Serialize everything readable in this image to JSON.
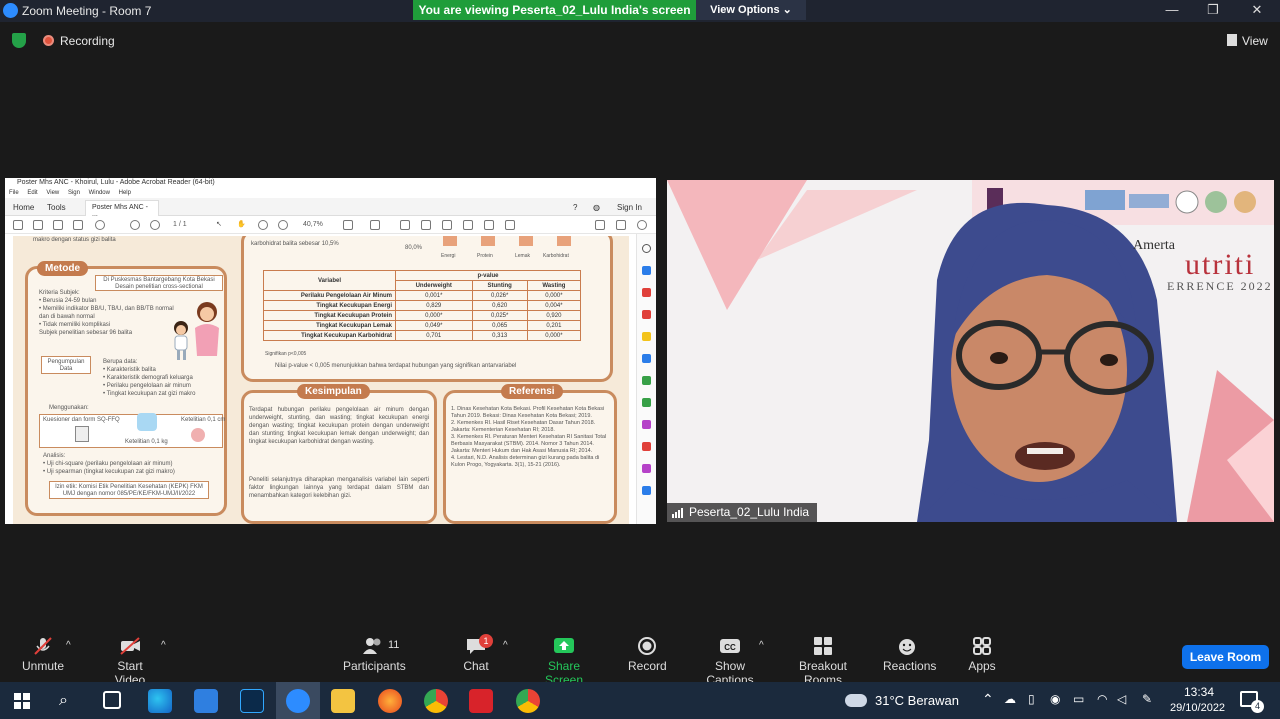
{
  "window": {
    "title": "Zoom Meeting - Room 7",
    "viewing_banner": "You are viewing Peserta_02_Lulu India's screen",
    "view_options": "View Options"
  },
  "top": {
    "recording": "Recording",
    "view": "View"
  },
  "acrobat": {
    "title": "Poster Mhs ANC - Khoirul, Lulu - Adobe Acrobat Reader (64-bit)",
    "menu": [
      "File",
      "Edit",
      "View",
      "Sign",
      "Window",
      "Help"
    ],
    "tabs": [
      "Home",
      "Tools"
    ],
    "active_tab": "Poster Mhs ANC - ...",
    "sign_in": "Sign In",
    "page": "1 / 1",
    "zoom": "40,7%"
  },
  "poster": {
    "metode_title": "Metode",
    "location": "Di Puskesmas Bantargebang Kota Bekasi Desain penelitian cross-sectional",
    "kriteria": "Kriteria Subjek:\n• Berusia 24-59 bulan\n• Memiliki indikator BB/U, TB/U, dan BB/TB normal dan di bawah normal\n• Tidak memiliki komplikasi\nSubjek penelitian sebesar 96 balita",
    "pengumpulan": "Pengumpulan Data",
    "berupa": "Berupa data:\n• Karakteristik balita\n• Karakteristik demografi keluarga\n• Perilaku pengelolaan air minum\n• Tingkat kecukupan zat gizi makro",
    "menggunakan": "Menggunakan:",
    "kuesioner": "Kuesioner dan form SQ-FFQ",
    "ketelitian_a": "Ketelitian 0,1 cm",
    "ketelitian_b": "Ketelitian 0,1 kg",
    "analisis": "Analisis:\n• Uji chi-square (perilaku pengelolaan air minum)\n• Uji spearman (tingkat kecukupan zat gizi makro)",
    "etik": "Izin etik: Komisi Etik Penelitian Kesehatan (KEPK) FKM UMJ dengan nomor 085/PE/KE/FKM-UMJ/II/2022",
    "top_note": "makro dengan status gizi balita",
    "carb_note": "karbohidrat balita sebesar 10,5%",
    "chart_labels": [
      "Energi",
      "Protein",
      "Lemak",
      "Karbohidrat"
    ],
    "chart_pct": "80,0%",
    "table_head": [
      "Variabel",
      "p-value"
    ],
    "table_sub": [
      "Underweight",
      "Stunting",
      "Wasting"
    ],
    "table_rows": [
      [
        "Perilaku Pengelolaan Air Minum",
        "0,001*",
        "0,026*",
        "0,000*"
      ],
      [
        "Tingkat Kecukupan Energi",
        "0,829",
        "0,620",
        "0,004*"
      ],
      [
        "Tingkat Kecukupan Protein",
        "0,000*",
        "0,025*",
        "0,920"
      ],
      [
        "Tingkat Kecukupan Lemak",
        "0,049*",
        "0,065",
        "0,201"
      ],
      [
        "Tingkat Kecukupan Karbohidrat",
        "0,701",
        "0,313",
        "0,000*"
      ]
    ],
    "signif": "Signifikan p<0,005",
    "nilai": "Nilai p-value < 0,005 menunjukkan bahwa terdapat hubungan yang signifikan antarvariabel",
    "kesimpulan_title": "Kesimpulan",
    "kesimpulan": "Terdapat hubungan perilaku pengelolaan air minum dengan underweight, stunting, dan wasting; tingkat kecukupan energi dengan wasting; tingkat kecukupan protein dengan underweight dan stunting; tingkat kecukupan lemak dengan underweight; dan tingkat kecukupan karbohidrat dengan wasting.",
    "saran": "Peneliti selanjutnya diharapkan menganalisis variabel lain seperti faktor lingkungan lainnya yang terdapat dalam STBM dan menambahkan kategori kelebihan gizi.",
    "referensi_title": "Referensi",
    "referensi": "1. Dinas Kesehatan Kota Bekasi. Profil Kesehatan Kota Bekasi Tahun 2019. Bekasi: Dinas Kesehatan Kota Bekasi; 2019.\n2. Kemenkes RI. Hasil Riset Kesehatan Dasar Tahun 2018. Jakarta: Kementerian Kesehatan RI; 2018.\n3. Kemenkes RI. Peraturan Menteri Kesehatan RI Sanitasi Total Berbasis Masyarakat (STBM). 2014. Nomor 3 Tahun 2014. Jakarta: Menteri Hukum dan Hak Asasi Manusia RI; 2014.\n4. Lestari, N.D. Analisis determinan gizi kurang pada balita di Kulon Progo, Yogyakarta. 3(1), 15-21 (2016)."
  },
  "participant": {
    "name": "Peserta_02_Lulu India",
    "bg_brand": "Amerta",
    "bg_title": "utriti",
    "bg_sub": "ERRENCE 2022"
  },
  "toolbar": {
    "unmute": "Unmute",
    "start_video": "Start Video",
    "participants": "Participants",
    "participants_count": "11",
    "chat": "Chat",
    "chat_badge": "1",
    "share": "Share Screen",
    "record": "Record",
    "captions": "Show Captions",
    "breakout": "Breakout Rooms",
    "reactions": "Reactions",
    "apps": "Apps",
    "leave": "Leave Room"
  },
  "taskbar": {
    "weather": "31°C  Berawan",
    "time": "13:34",
    "date": "29/10/2022",
    "notif": "4"
  },
  "colors": {
    "zoom_green": "#1f9d3a",
    "leave_blue": "#0e71eb",
    "share_green": "#24c75a",
    "poster_brown": "#c47b4e"
  }
}
